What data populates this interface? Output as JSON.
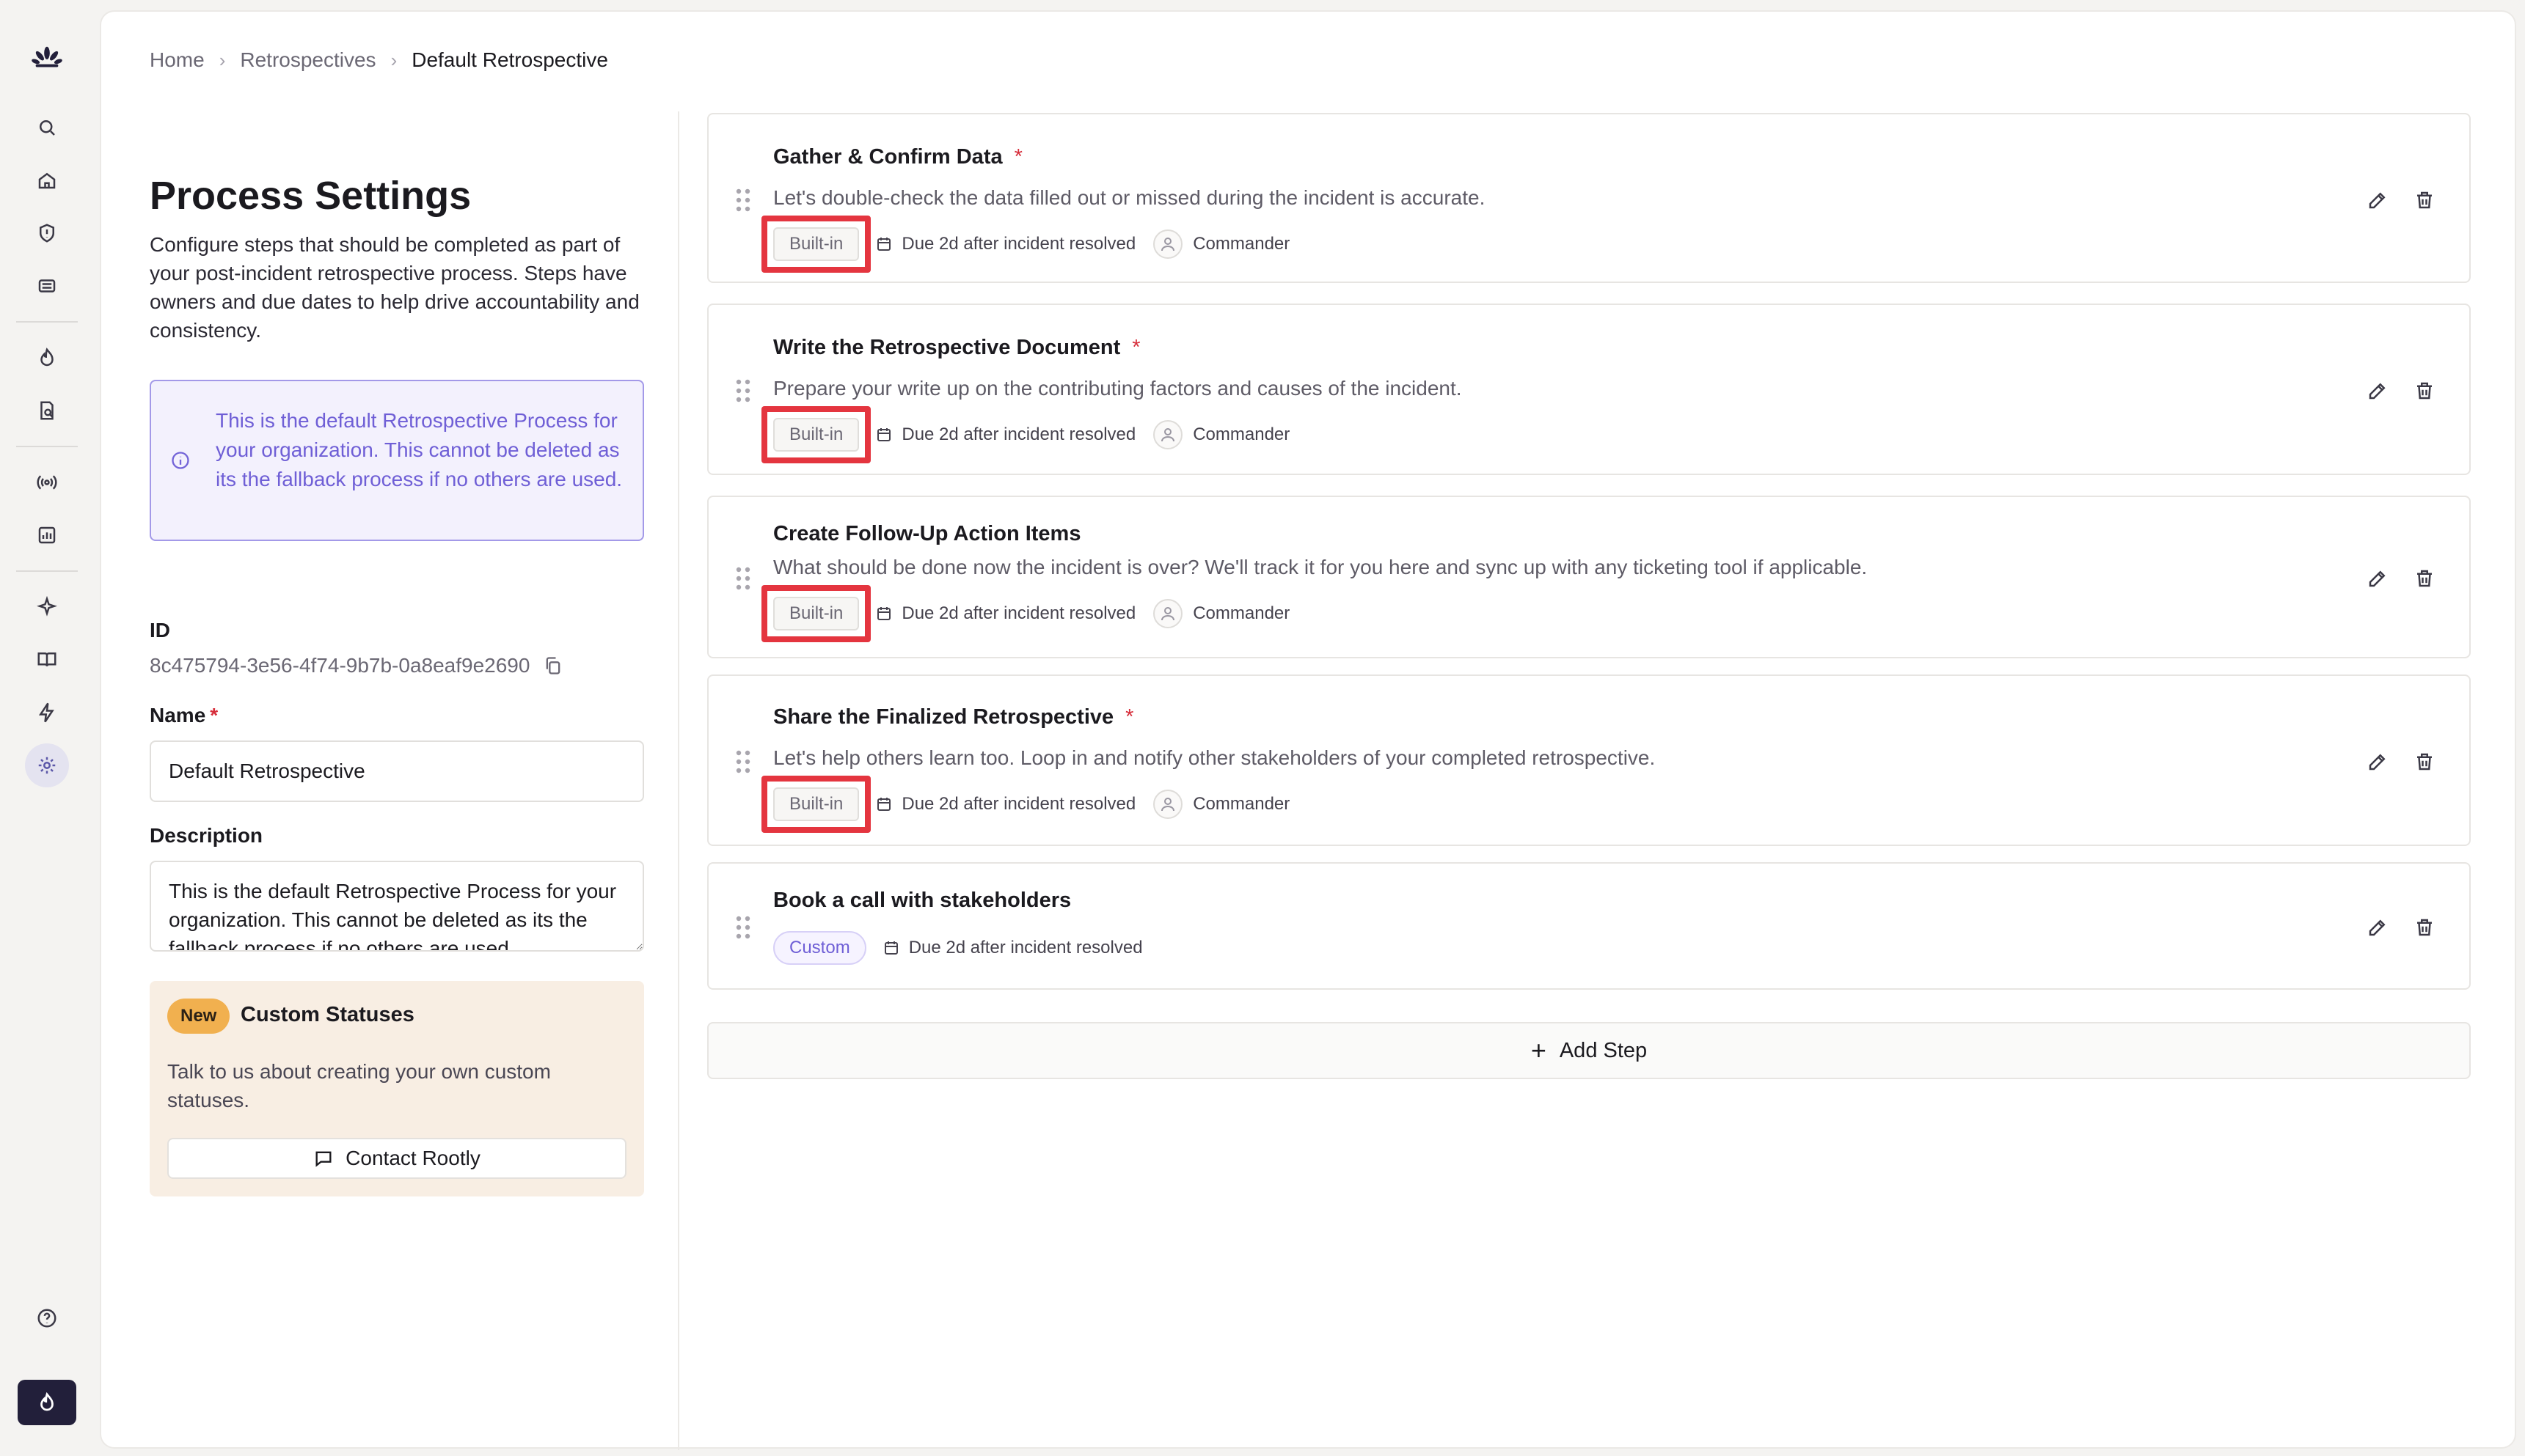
{
  "nav": {
    "icons": [
      "rootly-logo-icon",
      "search-icon",
      "home-icon",
      "incidents-icon",
      "alerts-icon",
      "on-call-icon",
      "retrospectives-icon",
      "status-pages-icon",
      "metrics-icon",
      "ai-icon",
      "catalog-icon",
      "workflows-icon",
      "settings-icon",
      "help-icon",
      "declare-incident-icon"
    ]
  },
  "breadcrumb": {
    "items": [
      "Home",
      "Retrospectives"
    ],
    "current": "Default Retrospective",
    "separator": "›"
  },
  "settings": {
    "title": "Process Settings",
    "description": "Configure steps that should be completed as part of your post-incident retrospective process. Steps have owners and due dates to help drive accountability and consistency.",
    "info_notice": "This is the default Retrospective Process for your organization. This cannot be deleted as its the fallback process if no others are used.",
    "id_label": "ID",
    "id_value": "8c475794-3e56-4f74-9b7b-0a8eaf9e2690",
    "name_label": "Name",
    "name_required": "*",
    "name_value": "Default Retrospective",
    "description_label": "Description",
    "description_value": "This is the default Retrospective Process for your organization. This cannot be deleted as its the fallback process if no others are used."
  },
  "promo": {
    "badge": "New",
    "title": "Custom Statuses",
    "text": "Talk to us about creating your own custom statuses.",
    "button_label": "Contact Rootly"
  },
  "steps": [
    {
      "title": "Gather & Confirm Data",
      "required": "*",
      "description": "Let's double-check the data filled out or missed during the incident is accurate.",
      "tag": "Built-in",
      "due": "Due 2d after incident resolved",
      "owner": "Commander"
    },
    {
      "title": "Write the Retrospective Document",
      "required": "*",
      "description": "Prepare your write up on the contributing factors and causes of the incident.",
      "tag": "Built-in",
      "due": "Due 2d after incident resolved",
      "owner": "Commander"
    },
    {
      "title": "Create Follow-Up Action Items",
      "required": "",
      "description": "What should be done now the incident is over? We'll track it for you here and sync up with any ticketing tool if applicable.",
      "tag": "Built-in",
      "due": "Due 2d after incident resolved",
      "owner": "Commander"
    },
    {
      "title": "Share the Finalized Retrospective",
      "required": "*",
      "description": "Let's help others learn too. Loop in and notify other stakeholders of your completed retrospective.",
      "tag": "Built-in",
      "due": "Due 2d after incident resolved",
      "owner": "Commander"
    },
    {
      "title": "Book a call with stakeholders",
      "required": "",
      "description": "",
      "tag": "Custom",
      "due": "Due 2d after incident resolved",
      "owner": ""
    }
  ],
  "add_step_label": "Add Step",
  "colors": {
    "accent": "#6f5fd6",
    "highlight": "#e4353f",
    "required": "#d62d3a",
    "new_badge": "#f1b04f"
  }
}
